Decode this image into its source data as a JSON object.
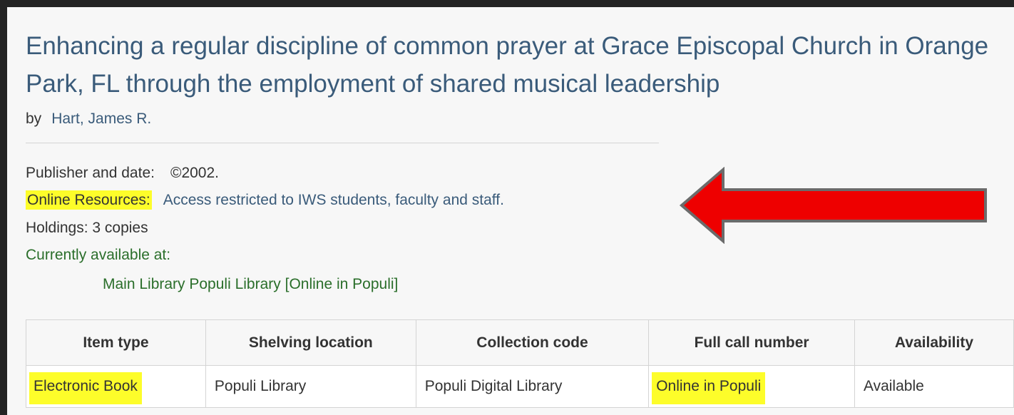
{
  "record": {
    "title": "Enhancing a regular discipline of common prayer at Grace Episcopal Church in Orange Park, FL through the employment of shared musical leadership",
    "by_label": "by",
    "author": "Hart, James R."
  },
  "details": {
    "publisher_label": "Publisher and date:",
    "publisher_value": "©2002.",
    "online_label": "Online Resources:",
    "online_value": "Access restricted to IWS students, faculty and staff.",
    "holdings_text": "Holdings: 3 copies",
    "available_label": "Currently available at:",
    "available_value": "Main Library Populi Library [Online in Populi]"
  },
  "table": {
    "headers": [
      "Item type",
      "Shelving location",
      "Collection code",
      "Full call number",
      "Availability"
    ],
    "rows": [
      [
        "Electronic Book",
        "Populi Library",
        "Populi Digital Library",
        "Online in Populi",
        "Available"
      ]
    ]
  },
  "colors": {
    "highlight": "#fdfd2a",
    "arrow_fill": "#ee0000",
    "arrow_stroke": "#6b6b6b",
    "link": "#3a5b7a",
    "available": "#2a6e2a"
  },
  "icons": {
    "annotation": "red-left-arrow"
  }
}
